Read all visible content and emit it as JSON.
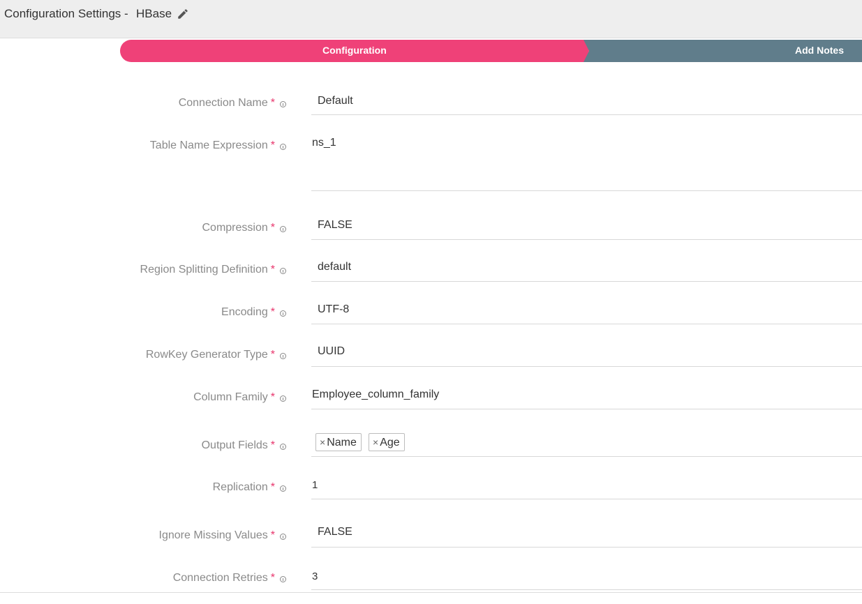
{
  "header": {
    "title": "Configuration Settings -",
    "name": "HBase",
    "edit_icon": "pencil-icon"
  },
  "stepper": {
    "steps": [
      {
        "label": "Configuration",
        "color": "#ef4178",
        "active": true
      },
      {
        "label": "Add Notes",
        "color": "#607d8b",
        "active": false
      }
    ]
  },
  "colors": {
    "required": "#e8356c",
    "label": "#8a8a8a",
    "divider": "#d8d8d8"
  },
  "form": {
    "fields": [
      {
        "label": "Connection Name",
        "required": "*",
        "value": "Default"
      },
      {
        "label": "Table Name Expression",
        "required": "*",
        "value": "ns_1"
      },
      {
        "label": "Compression",
        "required": "*",
        "value": "FALSE"
      },
      {
        "label": "Region Splitting Definition",
        "required": "*",
        "value": "default"
      },
      {
        "label": "Encoding",
        "required": "*",
        "value": "UTF-8"
      },
      {
        "label": "RowKey Generator Type",
        "required": "*",
        "value": "UUID"
      },
      {
        "label": "Column Family",
        "required": "*",
        "value": "Employee_column_family"
      },
      {
        "label": "Output Fields",
        "required": "*",
        "tags": [
          "Name",
          "Age"
        ],
        "remove_glyph": "×"
      },
      {
        "label": "Replication",
        "required": "*",
        "value": "1"
      },
      {
        "label": "Ignore Missing Values",
        "required": "*",
        "value": "FALSE"
      },
      {
        "label": "Connection Retries",
        "required": "*",
        "value": "3"
      }
    ]
  }
}
